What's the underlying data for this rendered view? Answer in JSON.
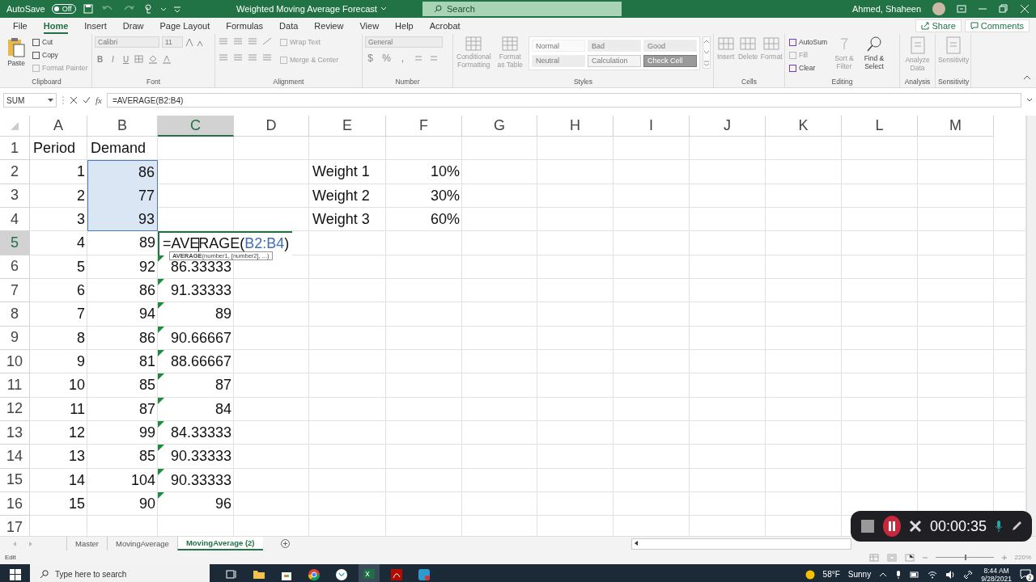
{
  "title_bar": {
    "autosave_label": "AutoSave",
    "autosave_state": "Off",
    "autosave_on": false,
    "document_title": "Weighted Moving Average Forecast",
    "search_placeholder": "Search",
    "user_name": "Ahmed, Shaheen"
  },
  "menu_tabs": [
    {
      "label": "File",
      "selected": false
    },
    {
      "label": "Home",
      "selected": true
    },
    {
      "label": "Insert",
      "selected": false
    },
    {
      "label": "Draw",
      "selected": false
    },
    {
      "label": "Page Layout",
      "selected": false
    },
    {
      "label": "Formulas",
      "selected": false
    },
    {
      "label": "Data",
      "selected": false
    },
    {
      "label": "Review",
      "selected": false
    },
    {
      "label": "View",
      "selected": false
    },
    {
      "label": "Help",
      "selected": false
    },
    {
      "label": "Acrobat",
      "selected": false
    }
  ],
  "share_button": "Share",
  "comments_button": "Comments",
  "ribbon_groups": [
    {
      "kind": "clipboard",
      "label": "Clipboard",
      "paste": "Paste",
      "commands": [
        {
          "label": "Cut",
          "disabled": false
        },
        {
          "label": "Copy",
          "disabled": false
        },
        {
          "label": "Format Painter",
          "disabled": true
        }
      ]
    },
    {
      "kind": "font",
      "label": "Font",
      "font_name": "Calibri",
      "font_size": "11",
      "format_buttons": [
        "B",
        "I",
        "U"
      ]
    },
    {
      "kind": "alignment",
      "label": "Alignment",
      "commands": [
        {
          "label": "Wrap Text",
          "disabled": true
        },
        {
          "label": "Merge & Center",
          "disabled": true
        }
      ]
    },
    {
      "kind": "number",
      "label": "Number",
      "format": "General",
      "symbols": [
        "$",
        "%",
        ","
      ]
    },
    {
      "kind": "styles",
      "label": "Styles",
      "commands": [
        {
          "label": "Conditional Formatting",
          "disabled": true
        },
        {
          "label": "Format as Table",
          "disabled": true
        }
      ],
      "styles": [
        {
          "label": "Normal",
          "kind": "normal"
        },
        {
          "label": "Bad",
          "kind": "bad"
        },
        {
          "label": "Good",
          "kind": "good"
        },
        {
          "label": "Neutral",
          "kind": "neutral"
        },
        {
          "label": "Calculation",
          "kind": "calculation"
        },
        {
          "label": "Check Cell",
          "kind": "check"
        }
      ]
    },
    {
      "kind": "cells",
      "label": "Cells",
      "commands": [
        {
          "label": "Insert",
          "disabled": true
        },
        {
          "label": "Delete",
          "disabled": true
        },
        {
          "label": "Format",
          "disabled": true
        }
      ]
    },
    {
      "kind": "editing",
      "label": "Editing",
      "commands": [
        {
          "label": "AutoSum",
          "disabled": false
        },
        {
          "label": "Fill",
          "disabled": true
        },
        {
          "label": "Clear",
          "disabled": false
        }
      ],
      "large": [
        {
          "label": "Sort & Filter",
          "disabled": true
        },
        {
          "label": "Find & Select",
          "disabled": false
        }
      ]
    },
    {
      "kind": "single",
      "label": "Analysis",
      "commands": [
        {
          "label": "Analyze Data",
          "disabled": true
        }
      ]
    },
    {
      "kind": "single",
      "label": "Sensitivity",
      "commands": [
        {
          "label": "Sensitivity",
          "disabled": true
        }
      ]
    }
  ],
  "formula_bar": {
    "name_box": "SUM",
    "function_button": "fx",
    "formula": "=AVERAGE(B2:B4)"
  },
  "columns": [
    {
      "label": "A",
      "selected": false
    },
    {
      "label": "B",
      "selected": false
    },
    {
      "label": "C",
      "selected": true
    },
    {
      "label": "D",
      "selected": false
    },
    {
      "label": "E",
      "selected": false
    },
    {
      "label": "F",
      "selected": false
    },
    {
      "label": "G",
      "selected": false
    },
    {
      "label": "H",
      "selected": false
    },
    {
      "label": "I",
      "selected": false
    },
    {
      "label": "J",
      "selected": false
    },
    {
      "label": "K",
      "selected": false
    },
    {
      "label": "L",
      "selected": false
    },
    {
      "label": "M",
      "selected": false
    }
  ],
  "rows": [
    {
      "number": "1",
      "selected": false,
      "cells": [
        {
          "kind": "text",
          "text": "Period"
        },
        {
          "kind": "text",
          "text": "Demand"
        }
      ]
    },
    {
      "number": "2",
      "selected": false,
      "cells": [
        {
          "kind": "number",
          "text": "1"
        },
        {
          "kind": "number",
          "text": "86",
          "selected": true
        },
        {
          "kind": "blank"
        },
        {
          "kind": "blank"
        },
        {
          "kind": "text",
          "text": "Weight 1"
        },
        {
          "kind": "number",
          "text": "10%"
        }
      ]
    },
    {
      "number": "3",
      "selected": false,
      "cells": [
        {
          "kind": "number",
          "text": "2"
        },
        {
          "kind": "number",
          "text": "77",
          "selected": true
        },
        {
          "kind": "blank"
        },
        {
          "kind": "blank"
        },
        {
          "kind": "text",
          "text": "Weight 2"
        },
        {
          "kind": "number",
          "text": "30%"
        }
      ]
    },
    {
      "number": "4",
      "selected": false,
      "cells": [
        {
          "kind": "number",
          "text": "3"
        },
        {
          "kind": "number",
          "text": "93",
          "selected": true
        },
        {
          "kind": "blank"
        },
        {
          "kind": "blank"
        },
        {
          "kind": "text",
          "text": "Weight 3"
        },
        {
          "kind": "number",
          "text": "60%"
        }
      ]
    },
    {
      "number": "5",
      "selected": true,
      "cells": [
        {
          "kind": "number",
          "text": "4"
        },
        {
          "kind": "number",
          "text": "89"
        },
        {
          "kind": "edit",
          "prefix": "=AVERAGE(",
          "reference": "B2:B4",
          "suffix": ")",
          "tooltip": "**AVERAGE**(number1, [number2], ...)"
        }
      ]
    },
    {
      "number": "6",
      "selected": false,
      "cells": [
        {
          "kind": "number",
          "text": "5"
        },
        {
          "kind": "number",
          "text": "92"
        },
        {
          "kind": "number",
          "text": "86.33333",
          "flag": true
        }
      ]
    },
    {
      "number": "7",
      "selected": false,
      "cells": [
        {
          "kind": "number",
          "text": "6"
        },
        {
          "kind": "number",
          "text": "86"
        },
        {
          "kind": "number",
          "text": "91.33333",
          "flag": true
        }
      ]
    },
    {
      "number": "8",
      "selected": false,
      "cells": [
        {
          "kind": "number",
          "text": "7"
        },
        {
          "kind": "number",
          "text": "94"
        },
        {
          "kind": "number",
          "text": "89",
          "flag": true
        }
      ]
    },
    {
      "number": "9",
      "selected": false,
      "cells": [
        {
          "kind": "number",
          "text": "8"
        },
        {
          "kind": "number",
          "text": "86"
        },
        {
          "kind": "number",
          "text": "90.66667",
          "flag": true
        }
      ]
    },
    {
      "number": "10",
      "selected": false,
      "cells": [
        {
          "kind": "number",
          "text": "9"
        },
        {
          "kind": "number",
          "text": "81"
        },
        {
          "kind": "number",
          "text": "88.66667",
          "flag": true
        }
      ]
    },
    {
      "number": "11",
      "selected": false,
      "cells": [
        {
          "kind": "number",
          "text": "10"
        },
        {
          "kind": "number",
          "text": "85"
        },
        {
          "kind": "number",
          "text": "87",
          "flag": true
        }
      ]
    },
    {
      "number": "12",
      "selected": false,
      "cells": [
        {
          "kind": "number",
          "text": "11"
        },
        {
          "kind": "number",
          "text": "87"
        },
        {
          "kind": "number",
          "text": "84",
          "flag": true
        }
      ]
    },
    {
      "number": "13",
      "selected": false,
      "cells": [
        {
          "kind": "number",
          "text": "12"
        },
        {
          "kind": "number",
          "text": "99"
        },
        {
          "kind": "number",
          "text": "84.33333",
          "flag": true
        }
      ]
    },
    {
      "number": "14",
      "selected": false,
      "cells": [
        {
          "kind": "number",
          "text": "13"
        },
        {
          "kind": "number",
          "text": "85"
        },
        {
          "kind": "number",
          "text": "90.33333",
          "flag": true
        }
      ]
    },
    {
      "number": "15",
      "selected": false,
      "cells": [
        {
          "kind": "number",
          "text": "14"
        },
        {
          "kind": "number",
          "text": "104"
        },
        {
          "kind": "number",
          "text": "90.33333",
          "flag": true
        }
      ]
    },
    {
      "number": "16",
      "selected": false,
      "cells": [
        {
          "kind": "number",
          "text": "15"
        },
        {
          "kind": "number",
          "text": "90"
        },
        {
          "kind": "number",
          "text": "96",
          "flag": true
        }
      ]
    },
    {
      "number": "17",
      "selected": false
    }
  ],
  "sheet_tabs": [
    {
      "label": "Master",
      "selected": false
    },
    {
      "label": "MovingAverage",
      "selected": false
    },
    {
      "label": "MovingAverage (2)",
      "selected": true
    }
  ],
  "status_bar": {
    "mode": "Edit",
    "zoom": {
      "level": 0.5,
      "reading": "220%"
    }
  },
  "recorder": {
    "time": "00:00:35"
  },
  "taskbar": {
    "search_placeholder": "Type here to search",
    "temperature": "58°F",
    "weather": "Sunny",
    "time": "8:44 AM",
    "date": "9/28/2021",
    "notifications": "2"
  }
}
